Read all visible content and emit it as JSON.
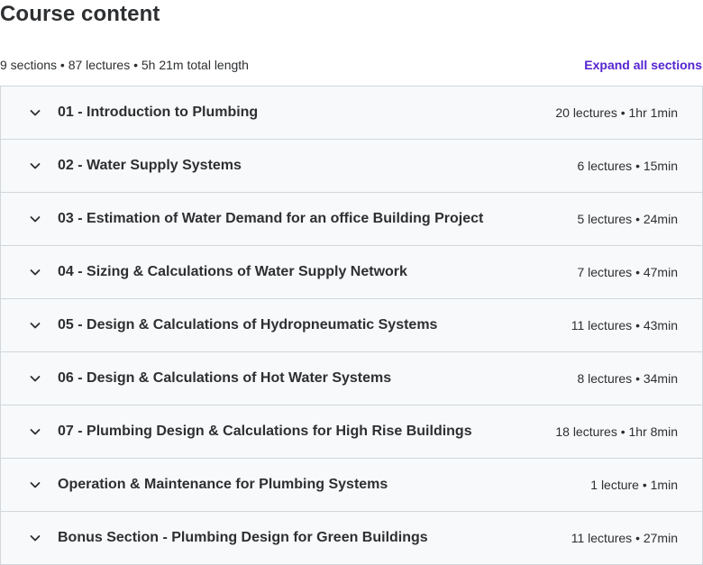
{
  "header": {
    "title": "Course content",
    "summary": "9 sections • 87 lectures • 5h 21m total length",
    "expand_all_label": "Expand all sections"
  },
  "colors": {
    "accent": "#5624d0",
    "section_background": "#f7f9fa",
    "border": "#d1d7dc",
    "text": "#2d2f31"
  },
  "sections": [
    {
      "title": "01 - Introduction to Plumbing",
      "meta": "20 lectures • 1hr 1min",
      "icon": "chevron-down-icon"
    },
    {
      "title": "02 - Water Supply Systems",
      "meta": "6 lectures • 15min",
      "icon": "chevron-down-icon"
    },
    {
      "title": "03 - Estimation of Water Demand for an office Building Project",
      "meta": "5 lectures • 24min",
      "icon": "chevron-down-icon"
    },
    {
      "title": "04 - Sizing & Calculations of Water Supply Network",
      "meta": "7 lectures • 47min",
      "icon": "chevron-down-icon"
    },
    {
      "title": "05 - Design & Calculations of Hydropneumatic Systems",
      "meta": "11 lectures • 43min",
      "icon": "chevron-down-icon"
    },
    {
      "title": "06 - Design & Calculations of Hot Water Systems",
      "meta": "8 lectures • 34min",
      "icon": "chevron-down-icon"
    },
    {
      "title": "07 - Plumbing Design & Calculations for High Rise Buildings",
      "meta": "18 lectures • 1hr 8min",
      "icon": "chevron-down-icon"
    },
    {
      "title": "Operation & Maintenance for Plumbing Systems",
      "meta": "1 lecture • 1min",
      "icon": "chevron-down-icon"
    },
    {
      "title": "Bonus Section - Plumbing Design for Green Buildings",
      "meta": "11 lectures • 27min",
      "icon": "chevron-down-icon"
    }
  ]
}
